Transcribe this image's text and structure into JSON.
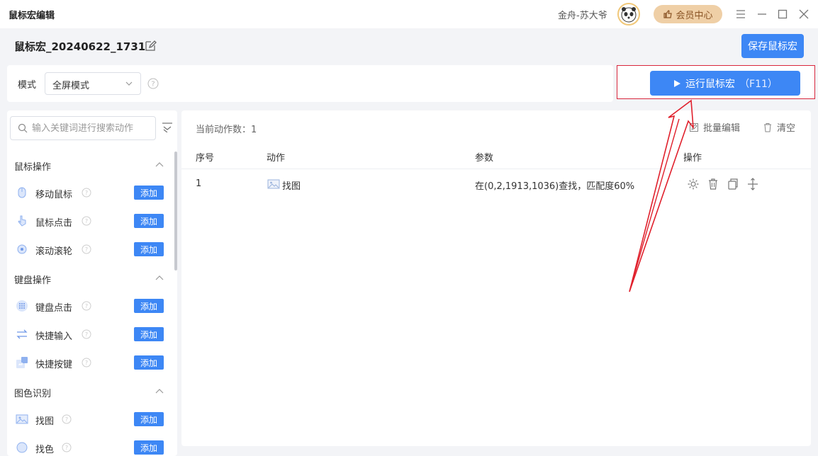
{
  "window": {
    "title": "鼠标宏编辑",
    "user_name": "金舟-苏大爷",
    "vip_label": "会员中心"
  },
  "header": {
    "macro_name": "鼠标宏_20240622_1731",
    "save_label": "保存鼠标宏"
  },
  "mode": {
    "label": "模式",
    "value": "全屏模式"
  },
  "run": {
    "label": "运行鼠标宏",
    "shortcut": "（F11）"
  },
  "sidebar": {
    "search_placeholder": "输入关键词进行搜索动作",
    "add_label": "添加",
    "groups": [
      {
        "title": "鼠标操作",
        "items": [
          "移动鼠标",
          "鼠标点击",
          "滚动滚轮"
        ]
      },
      {
        "title": "键盘操作",
        "items": [
          "键盘点击",
          "快捷输入",
          "快捷按键"
        ]
      },
      {
        "title": "图色识别",
        "items": [
          "找图",
          "找色"
        ]
      }
    ]
  },
  "main": {
    "count_label": "当前动作数：1",
    "batch_edit": "批量编辑",
    "clear": "清空",
    "columns": [
      "序号",
      "动作",
      "参数",
      "操作"
    ],
    "rows": [
      {
        "index": "1",
        "action": "找图",
        "params": "在(0,2,1913,1036)查找，匹配度60%"
      }
    ]
  },
  "colors": {
    "primary": "#3d87f5",
    "vip_bg": "#efcfa6",
    "annotation": "#d8263c"
  }
}
